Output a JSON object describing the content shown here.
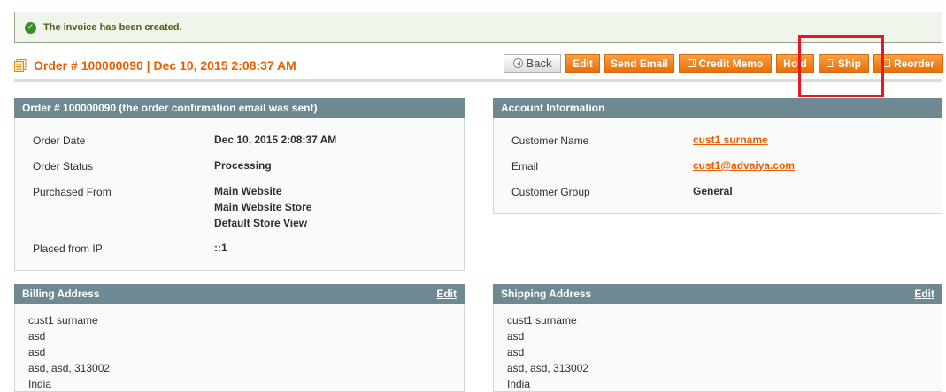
{
  "message": {
    "text": "The invoice has been created."
  },
  "order": {
    "title": "Order # 100000090 | Dec 10, 2015 2:08:37 AM"
  },
  "toolbar": {
    "back": "Back",
    "edit": "Edit",
    "send_email": "Send Email",
    "credit_memo": "Credit Memo",
    "hold": "Hold",
    "ship": "Ship",
    "reorder": "Reorder"
  },
  "order_panel": {
    "header": "Order # 100000090 (the order confirmation email was sent)",
    "order_date_label": "Order Date",
    "order_date": "Dec 10, 2015 2:08:37 AM",
    "status_label": "Order Status",
    "status": "Processing",
    "purchased_label": "Purchased From",
    "purchased": [
      "Main Website",
      "Main Website Store",
      "Default Store View"
    ],
    "ip_label": "Placed from IP",
    "ip": "::1"
  },
  "account_panel": {
    "header": "Account Information",
    "name_label": "Customer Name",
    "name": "cust1 surname",
    "email_label": "Email",
    "email": "cust1@advaiya.com",
    "group_label": "Customer Group",
    "group": "General"
  },
  "billing": {
    "header": "Billing Address",
    "edit": "Edit",
    "lines": [
      "cust1 surname",
      "asd",
      "asd",
      "asd, asd, 313002",
      "India"
    ]
  },
  "shipping": {
    "header": "Shipping Address",
    "edit": "Edit",
    "lines": [
      "cust1 surname",
      "asd",
      "asd",
      "asd, asd, 313002",
      "India"
    ]
  }
}
